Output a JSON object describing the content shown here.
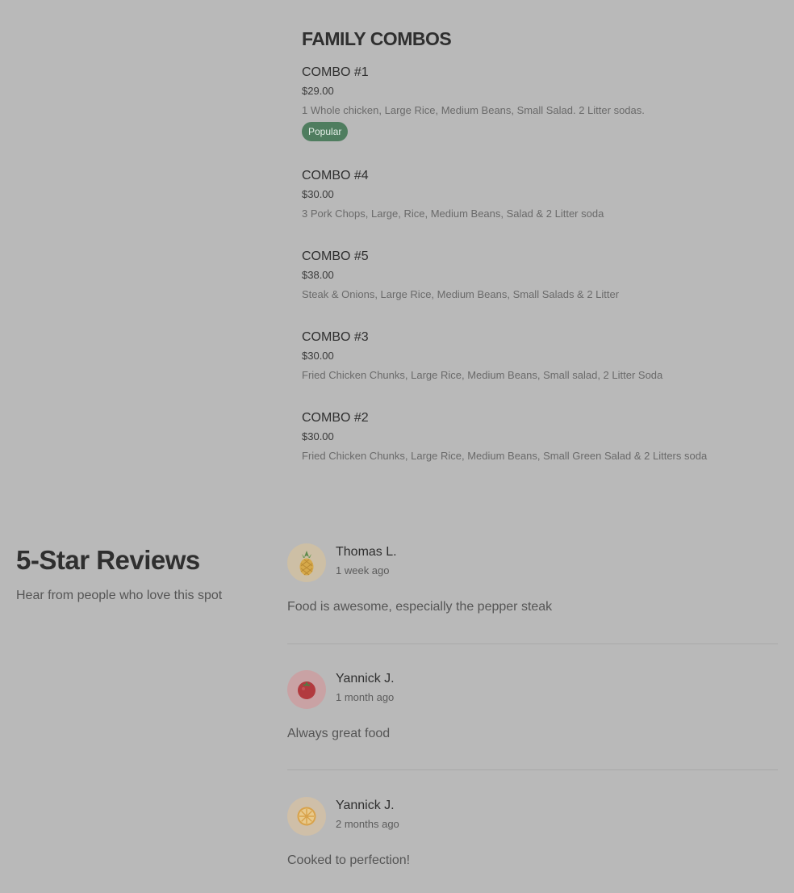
{
  "menu": {
    "section_title": "FAMILY COMBOS",
    "items": [
      {
        "name": "COMBO #1",
        "price": "$29.00",
        "description": "1 Whole chicken, Large Rice, Medium Beans, Small Salad. 2 Litter sodas.",
        "badge": "Popular"
      },
      {
        "name": "COMBO #4",
        "price": "$30.00",
        "description": "3 Pork Chops, Large, Rice, Medium Beans, Salad & 2 Litter soda"
      },
      {
        "name": "COMBO #5",
        "price": "$38.00",
        "description": "Steak & Onions, Large Rice, Medium Beans, Small Salads & 2 Litter"
      },
      {
        "name": "COMBO #3",
        "price": "$30.00",
        "description": "Fried Chicken Chunks, Large Rice, Medium Beans, Small salad, 2 Litter Soda"
      },
      {
        "name": "COMBO #2",
        "price": "$30.00",
        "description": "Fried Chicken Chunks, Large Rice, Medium Beans, Small Green Salad & 2 Litters soda"
      }
    ]
  },
  "reviews": {
    "title": "5-Star Reviews",
    "subtitle": "Hear from people who love this spot",
    "items": [
      {
        "name": "Thomas L.",
        "date": "1 week ago",
        "text": "Food is awesome, especially the pepper steak",
        "avatar_icon": "pineapple-icon",
        "avatar_bg": "#cdbfa5"
      },
      {
        "name": "Yannick J.",
        "date": "1 month ago",
        "text": "Always great food",
        "avatar_icon": "tomato-icon",
        "avatar_bg": "#c9a2a4"
      },
      {
        "name": "Yannick J.",
        "date": "2 months ago",
        "text": "Cooked to perfection!",
        "avatar_icon": "citrus-slice-icon",
        "avatar_bg": "#cfbfa8"
      }
    ]
  },
  "colors": {
    "page_background": "#b9b9b9",
    "popular_badge": "#4f7d5f"
  }
}
